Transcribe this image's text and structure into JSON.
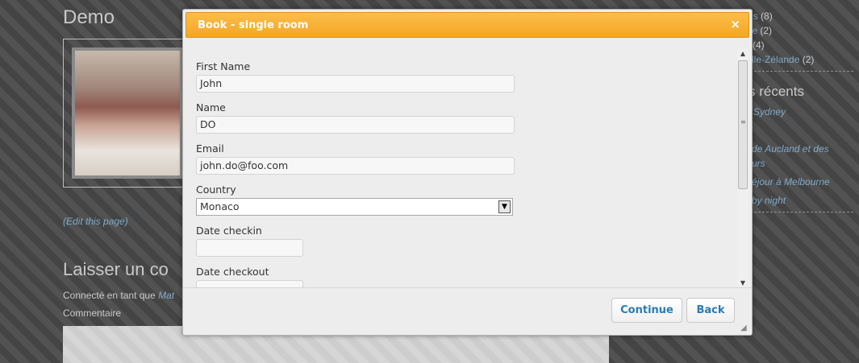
{
  "page": {
    "post_title": "Demo",
    "edit_link": "(Edit this page)",
    "leave_comment_heading": "Laisser un co",
    "connected_prefix": "Connecté en tant que",
    "connected_user": "Mat",
    "comment_label": "Commentaire"
  },
  "sidebar": {
    "top_items": [
      {
        "link": "es",
        "count": "(8)"
      },
      {
        "link": "lie",
        "count": "(2)"
      },
      {
        "link": "",
        "count": "(4)"
      },
      {
        "link": "lle-Zélande",
        "count": "(2)"
      }
    ],
    "recent_heading": "s récents",
    "recent_posts": [
      "Sydney",
      "de Aucland et des",
      "urs",
      "éjour à Melbourne",
      "by night"
    ]
  },
  "modal": {
    "title": "Book - single room",
    "close_glyph": "×",
    "fields": {
      "first_name": {
        "label": "First Name",
        "value": "John"
      },
      "name": {
        "label": "Name",
        "value": "DO"
      },
      "email": {
        "label": "Email",
        "value": "john.do@foo.com"
      },
      "country": {
        "label": "Country",
        "value": "Monaco"
      },
      "date_checkin": {
        "label": "Date checkin",
        "value": ""
      },
      "date_checkout": {
        "label": "Date checkout",
        "value": ""
      }
    },
    "buttons": {
      "continue": "Continue",
      "back": "Back"
    }
  }
}
